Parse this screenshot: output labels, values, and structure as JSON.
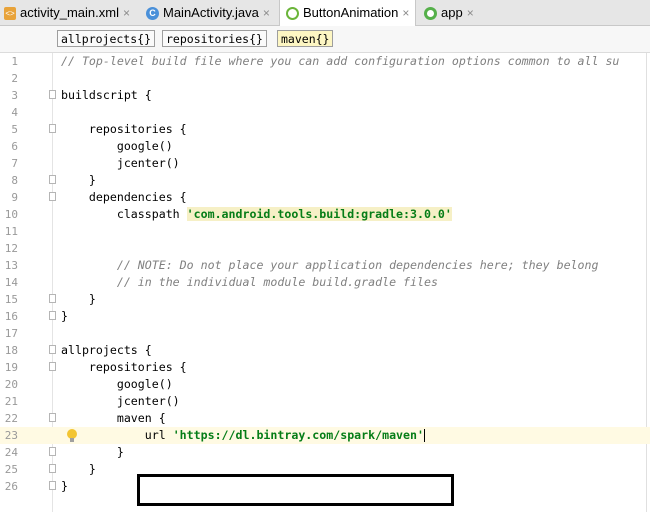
{
  "tabs": [
    {
      "label": "activity_main.xml",
      "icon": "xml-file-icon",
      "close": "×",
      "active": false
    },
    {
      "label": "MainActivity.java",
      "icon": "java-class-icon",
      "close": "×",
      "active": false
    },
    {
      "label": "ButtonAnimation",
      "icon": "android-module-icon",
      "close": "×",
      "active": true
    },
    {
      "label": "app",
      "icon": "app-module-icon",
      "close": "×",
      "active": false
    }
  ],
  "breadcrumbs": [
    "allprojects{}",
    "repositories{}",
    "maven{}"
  ],
  "editor": {
    "lines": [
      {
        "n": "1",
        "indent": "",
        "text": "// Top-level build file where you can add configuration options common to all su",
        "type": "comment"
      },
      {
        "n": "2",
        "indent": "",
        "text": "",
        "type": "plain"
      },
      {
        "n": "3",
        "indent": "",
        "text": "buildscript {",
        "type": "plain"
      },
      {
        "n": "4",
        "indent": "",
        "text": "",
        "type": "plain"
      },
      {
        "n": "5",
        "indent": "    ",
        "text": "repositories {",
        "type": "plain"
      },
      {
        "n": "6",
        "indent": "        ",
        "text": "google()",
        "type": "plain"
      },
      {
        "n": "7",
        "indent": "        ",
        "text": "jcenter()",
        "type": "plain"
      },
      {
        "n": "8",
        "indent": "    ",
        "text": "}",
        "type": "plain"
      },
      {
        "n": "9",
        "indent": "    ",
        "text": "dependencies {",
        "type": "plain"
      },
      {
        "n": "10",
        "indent": "        ",
        "text": "classpath ",
        "string": "'com.android.tools.build:gradle:3.0.0'",
        "type": "string"
      },
      {
        "n": "11",
        "indent": "",
        "text": "",
        "type": "plain"
      },
      {
        "n": "12",
        "indent": "",
        "text": "",
        "type": "plain"
      },
      {
        "n": "13",
        "indent": "        ",
        "text": "// NOTE: Do not place your application dependencies here; they belong",
        "type": "comment"
      },
      {
        "n": "14",
        "indent": "        ",
        "text": "// in the individual module build.gradle files",
        "type": "comment"
      },
      {
        "n": "15",
        "indent": "    ",
        "text": "}",
        "type": "plain"
      },
      {
        "n": "16",
        "indent": "",
        "text": "}",
        "type": "plain"
      },
      {
        "n": "17",
        "indent": "",
        "text": "",
        "type": "plain"
      },
      {
        "n": "18",
        "indent": "",
        "text": "allprojects {",
        "type": "plain"
      },
      {
        "n": "19",
        "indent": "    ",
        "text": "repositories {",
        "type": "plain"
      },
      {
        "n": "20",
        "indent": "        ",
        "text": "google()",
        "type": "plain"
      },
      {
        "n": "21",
        "indent": "        ",
        "text": "jcenter()",
        "type": "plain"
      },
      {
        "n": "22",
        "indent": "        ",
        "text": "maven {",
        "type": "plain"
      },
      {
        "n": "23",
        "indent": "            ",
        "text": "url ",
        "string": "'https://dl.bintray.com/spark/maven'",
        "type": "string",
        "current": true
      },
      {
        "n": "24",
        "indent": "        ",
        "text": "}",
        "type": "plain"
      },
      {
        "n": "25",
        "indent": "    ",
        "text": "}",
        "type": "plain"
      },
      {
        "n": "26",
        "indent": "",
        "text": "}",
        "type": "plain"
      }
    ],
    "fold_markers": [
      "3",
      "5",
      "8",
      "9",
      "15",
      "16",
      "18",
      "19",
      "22",
      "24",
      "25",
      "26"
    ],
    "intention_bulb_line": "23"
  },
  "colors": {
    "comment": "#808080",
    "string": "#067d17",
    "current_line": "#fffae3",
    "selected_crumb": "#fdf6c3"
  }
}
